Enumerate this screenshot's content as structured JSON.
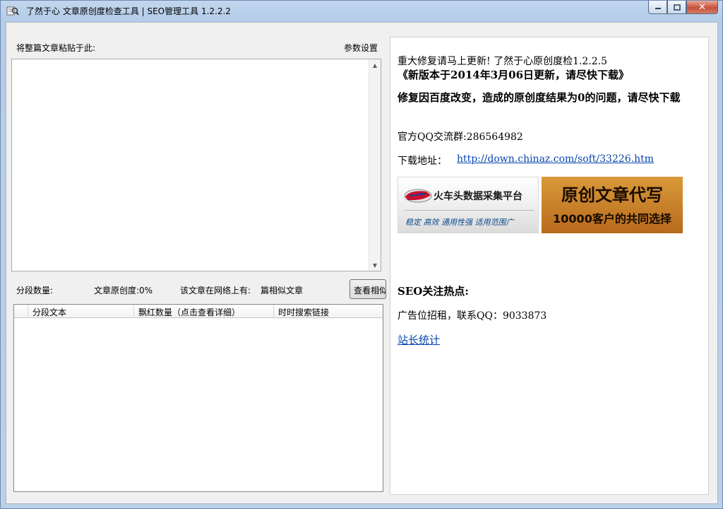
{
  "window": {
    "title": "了然于心 文章原创度检查工具 | SEO管理工具  1.2.2.2"
  },
  "left": {
    "paste_label": "将整篇文章粘贴于此:",
    "params_label": "参数设置",
    "segment_count_label": "分段数量:",
    "originality_label": "文章原创度:0%",
    "online_label": "该文章在网络上有:",
    "similar_label": "篇相似文章",
    "view_button_label": "查看相似"
  },
  "grid": {
    "columns": [
      "",
      "分段文本",
      "飘红数量（点击查看详细）",
      "时时搜索链接"
    ]
  },
  "browser": {
    "line1": "重大修复请马上更新!  了然于心原创度检1.2.2.5",
    "line2": "《新版本于2014年3月06日更新，请尽快下载》",
    "line3": "修复因百度改变，造成的原创度结果为0的问题，请尽快下载",
    "qq_group": "官方QQ交流群:286564982",
    "download_label": "下载地址：",
    "download_url": "http://down.chinaz.com/soft/33226.htm",
    "banner1_title": "火车头数据采集平台",
    "banner1_tags": "稳定 高效 通用性强 适用范围广",
    "banner2_title": "原创文章代写",
    "banner2_sub": "10000客户的共同选择",
    "seo_heading": "SEO关注热点:",
    "ad_text": "广告位招租，联系QQ：9033873",
    "stats_link": "站长统计"
  }
}
